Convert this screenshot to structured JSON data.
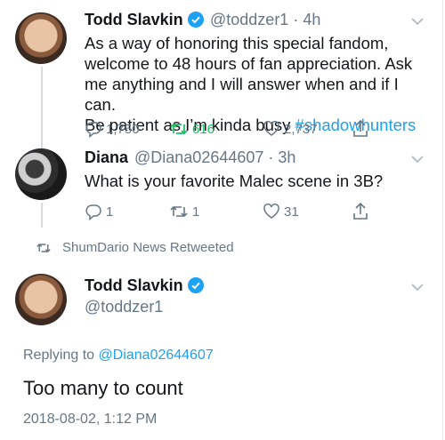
{
  "tweets": [
    {
      "name": "Todd Slavkin",
      "handle": "@toddzer1",
      "time_sep": "·",
      "time": "4h",
      "lines": [
        "As a way of honoring this special fandom,",
        "welcome to 48 hours of fan appreciation. Ask",
        "me anything and I will answer when and if I can."
      ],
      "last_line_text": "Be patient as I’m kinda busy ",
      "hashtag": "#shadowhunters",
      "replies": "1,750",
      "retweets": "616",
      "likes": "2,737"
    },
    {
      "name": "Diana",
      "handle": "@Diana02644607",
      "time_sep": "·",
      "time": "3h",
      "text": "What is your favorite Malec scene in 3B?",
      "replies": "1",
      "retweets": "1",
      "likes": "31"
    }
  ],
  "retweet_note": "ShumDario News Retweeted",
  "focus": {
    "name": "Todd Slavkin",
    "handle": "@toddzer1",
    "replying_prefix": "Replying to ",
    "replying_to": "@Diana02644607",
    "text": "Too many to count",
    "timestamp": "2018-08-02, 1:12 PM"
  },
  "icons": {
    "reply": "reply-icon",
    "retweet": "retweet-icon",
    "like": "heart-icon",
    "share": "share-icon",
    "more": "chevron-down-icon",
    "verified": "verified-badge-icon"
  },
  "colors": {
    "link": "#1da1f2",
    "retweet_active": "#17bf63",
    "secondary_text": "#657786",
    "primary_text": "#14171a"
  }
}
